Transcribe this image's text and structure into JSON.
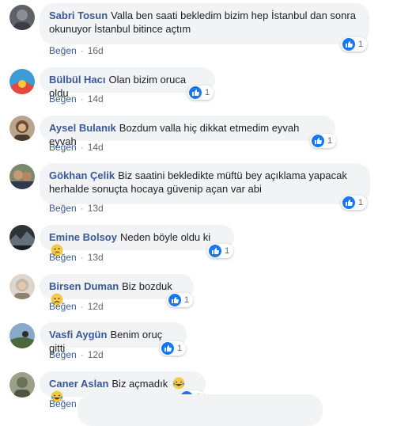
{
  "comments": [
    {
      "author": "Sabri Tosun",
      "text": "Valla ben saati bekledim bizim hep İstanbul dan sonra okunuyor İstanbul bitince açtım",
      "reactions": "1",
      "like_label": "Beğen",
      "age": "16d",
      "emoji": ""
    },
    {
      "author": "Bülbül Hacı",
      "text": "Olan bizim oruca oldu",
      "reactions": "1",
      "like_label": "Beğen",
      "age": "14d",
      "emoji": ""
    },
    {
      "author": "Aysel Bulanık",
      "text": "Bozdum valla hiç dikkat etmedim eyvah eyvah",
      "reactions": "1",
      "like_label": "Beğen",
      "age": "14d",
      "emoji": ""
    },
    {
      "author": "Gökhan Çelik",
      "text": "Biz saatini bekledikte müftü bey açıklama yapacak herhalde sonuçta hocaya güvenip açan var abi",
      "reactions": "1",
      "like_label": "Beğen",
      "age": "13d",
      "emoji": ""
    },
    {
      "author": "Emine Bolsoy",
      "text": "Neden böyle oldu ki",
      "reactions": "1",
      "like_label": "Beğen",
      "age": "13d",
      "emoji": "thinking-face-emoji"
    },
    {
      "author": "Birsen Duman",
      "text": "Biz bozduk",
      "reactions": "1",
      "like_label": "Beğen",
      "age": "12d",
      "emoji": "disappointed-face-emoji"
    },
    {
      "author": "Vasfi Aygün",
      "text": "Benim oruç gitti",
      "reactions": "1",
      "like_label": "Beğen",
      "age": "12d",
      "emoji": ""
    },
    {
      "author": "Caner Aslan",
      "text": "Biz açmadık",
      "reactions": "2",
      "like_label": "Beğen",
      "age": "12d",
      "emoji": "laughing-tears-emoji-x2"
    }
  ],
  "colors": {
    "author": "#385898",
    "bubble": "#f2f3f5",
    "like_blue": "#1877f2",
    "meta": "#606770"
  }
}
